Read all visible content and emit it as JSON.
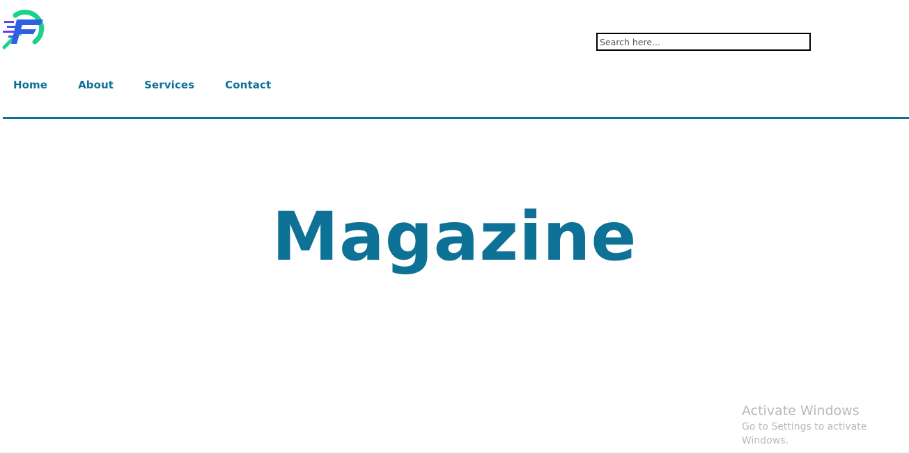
{
  "logo": {
    "icon": "speed-growth-logo-icon",
    "colors": {
      "green": "#19d38a",
      "blue": "#2f5fe6",
      "purple": "#6a3cf0"
    }
  },
  "search": {
    "placeholder": "Search here...",
    "value": ""
  },
  "nav": {
    "items": [
      {
        "label": "Home"
      },
      {
        "label": "About"
      },
      {
        "label": "Services"
      },
      {
        "label": "Contact"
      }
    ]
  },
  "hero": {
    "title": "Magazine"
  },
  "watermark": {
    "title": "Activate Windows",
    "subtitle": "Go to Settings to activate Windows."
  },
  "colors": {
    "accent": "#0e7196",
    "watermark": "#b9b9bd"
  }
}
